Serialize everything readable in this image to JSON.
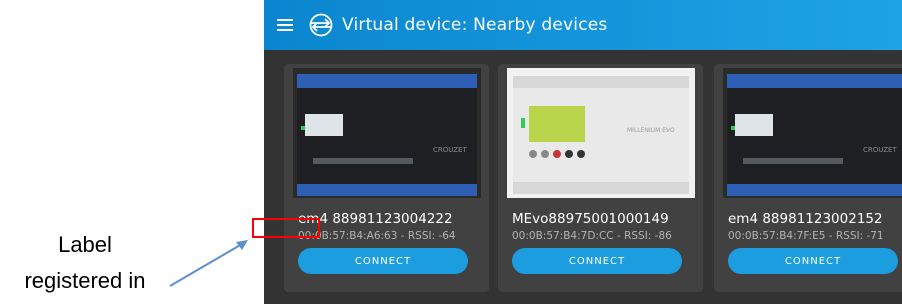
{
  "annotation": {
    "line1": "Label",
    "line2": "registered in"
  },
  "app": {
    "title": "Virtual device: Nearby devices",
    "menu_icon": "hamburger-menu-icon",
    "device_icon": "virtual-device-icon",
    "accent_color": "#1b9ddf"
  },
  "devices": [
    {
      "name": "em4 88981123004222",
      "info": "00:0B:57:B4:A6:63 - RSSI: -64",
      "button": "CONNECT"
    },
    {
      "name": "MEvo88975001000149",
      "info": "00:0B:57:B4:7D:CC - RSSI: -86",
      "button": "CONNECT"
    },
    {
      "name": "em4 88981123002152",
      "info": "00:0B:57:B4:7F:E5 - RSSI: -71",
      "button": "CONNECT"
    }
  ]
}
